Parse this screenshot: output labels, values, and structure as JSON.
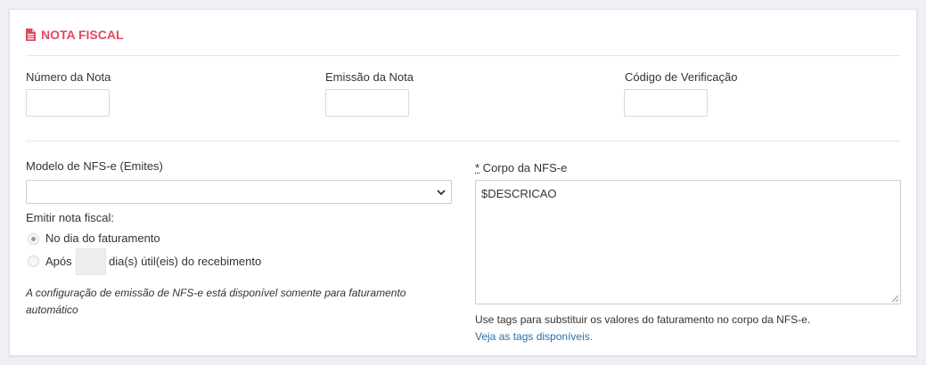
{
  "section": {
    "title": "NOTA FISCAL",
    "icon": "file-text-icon",
    "accent_color": "#e14b62"
  },
  "fields": {
    "numero_label": "Número da Nota",
    "emissao_label": "Emissão da Nota",
    "codigo_label": "Código de Verificação",
    "numero_value": "",
    "emissao_value": "",
    "codigo_value": ""
  },
  "modelo": {
    "label": "Modelo de NFS-e (Emites)",
    "selected": ""
  },
  "emitir": {
    "label": "Emitir nota fiscal:",
    "option1": "No dia do faturamento",
    "option2_prefix": "Após",
    "option2_suffix": "dia(s) útil(eis) do recebimento",
    "days_value": "",
    "selected_option": 1
  },
  "note": "A configuração de emissão de NFS-e está disponível somente para faturamento automático",
  "corpo": {
    "required_mark": "*",
    "label": " Corpo da NFS-e",
    "value": "$DESCRICAO",
    "help": "Use tags para substituir os valores do faturamento no corpo da NFS-e.",
    "link": "Veja as tags disponíveis.",
    "link_color": "#2a6fa8"
  }
}
